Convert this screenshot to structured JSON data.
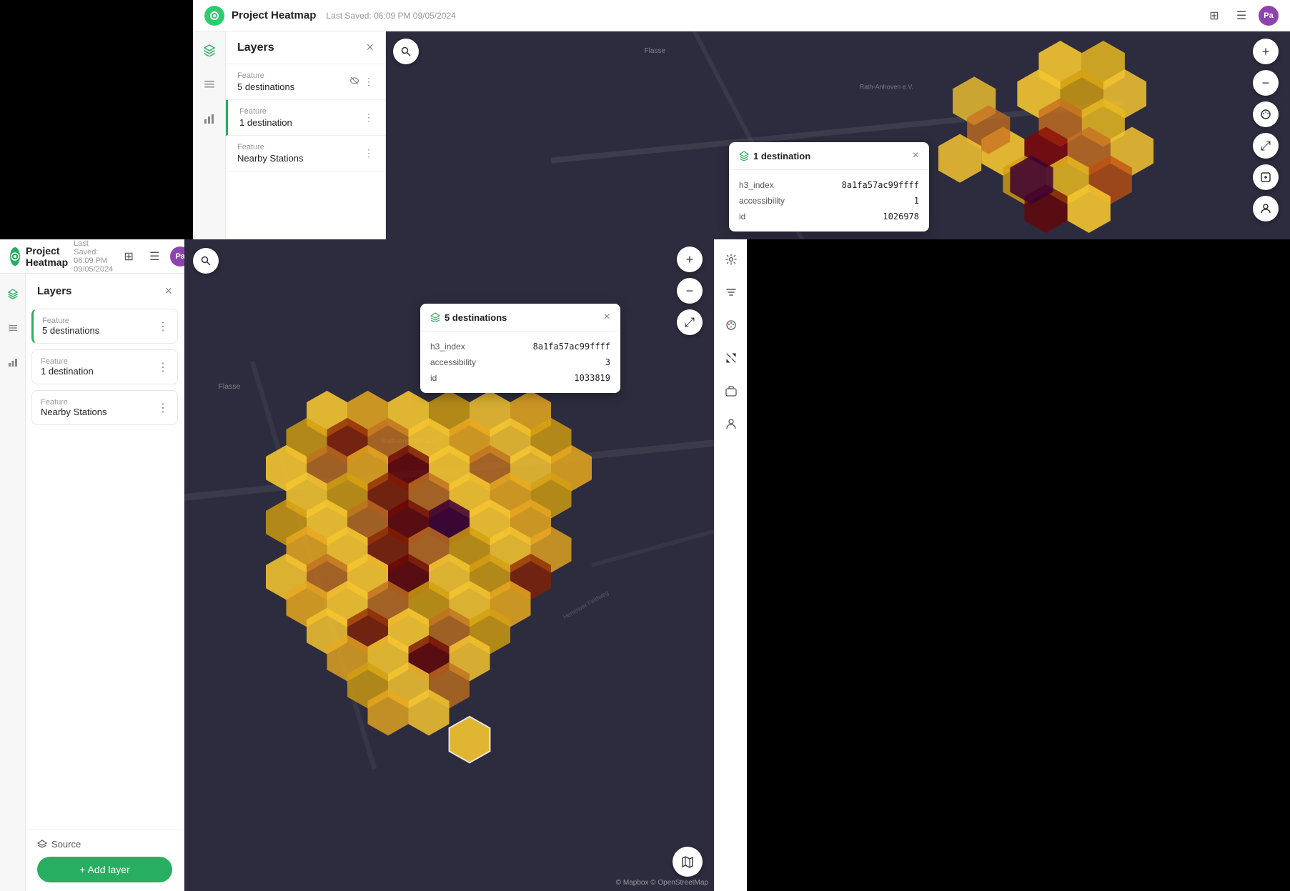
{
  "app": {
    "name": "Project Heatmap",
    "last_saved": "Last Saved: 06:09 PM 09/05/2024",
    "avatar": "Pa"
  },
  "top_panel": {
    "header": {
      "title": "Project Heatmap",
      "saved": "Last Saved: 06:09 PM 09/05/2024",
      "avatar": "Pa"
    },
    "layers_panel": {
      "title": "Layers",
      "layers": [
        {
          "label": "Feature",
          "name": "5 destinations",
          "active": false
        },
        {
          "label": "Feature",
          "name": "1 destination",
          "active": true
        },
        {
          "label": "Feature",
          "name": "Nearby Stations",
          "active": false
        }
      ]
    },
    "popup": {
      "title": "1 destination",
      "fields": [
        {
          "key": "h3_index",
          "value": "8a1fa57ac99ffff"
        },
        {
          "key": "accessibility",
          "value": "1"
        },
        {
          "key": "id",
          "value": "1026978"
        }
      ]
    }
  },
  "bottom_panel": {
    "header": {
      "title": "Project Heatmap",
      "saved": "Last Saved: 06:09 PM 09/05/2024",
      "avatar": "Pa"
    },
    "layers_panel": {
      "title": "Layers",
      "close_label": "×",
      "layers": [
        {
          "label": "Feature",
          "name": "5 destinations",
          "active": true
        },
        {
          "label": "Feature",
          "name": "1 destination",
          "active": false
        },
        {
          "label": "Feature",
          "name": "Nearby Stations",
          "active": false
        }
      ]
    },
    "source": {
      "label": "Source"
    },
    "add_layer_btn": "+ Add layer",
    "popup": {
      "title": "5 destinations",
      "fields": [
        {
          "key": "h3_index",
          "value": "8a1fa57ac99ffff"
        },
        {
          "key": "accessibility",
          "value": "3"
        },
        {
          "key": "id",
          "value": "1033819"
        }
      ]
    },
    "copyright": "© Mapbox © OpenStreetMap"
  },
  "icons": {
    "layers": "≡",
    "list": "☰",
    "chart": "⬛",
    "close": "×",
    "more": "⋮",
    "eye_off": "👁",
    "zoom_in": "+",
    "zoom_out": "−",
    "palette": "🎨",
    "expand": "⤢",
    "settings": "⚙",
    "filter": "▽",
    "layers_icon": "⊞",
    "person": "👤",
    "search": "🔍",
    "map": "🗺",
    "plus": "+",
    "grid": "⊞"
  }
}
